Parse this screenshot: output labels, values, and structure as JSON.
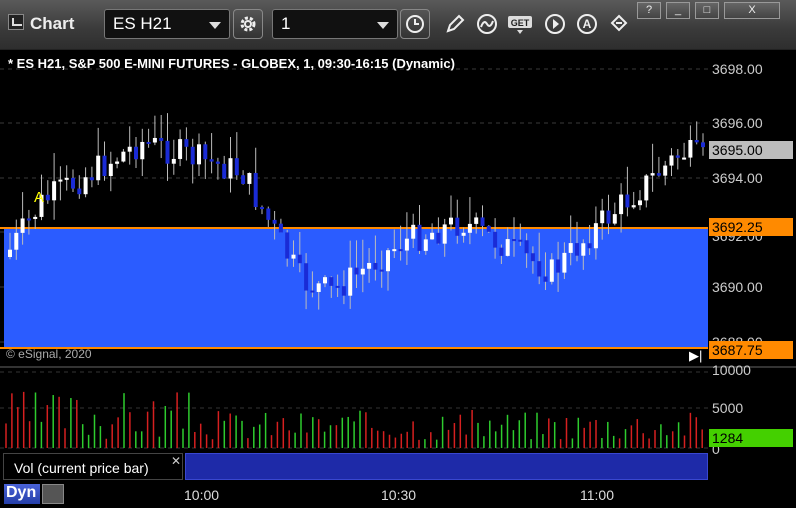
{
  "app": {
    "title": "Chart"
  },
  "toolbar": {
    "symbol": "ES H21",
    "interval": "1",
    "tools": [
      {
        "name": "settings-icon"
      },
      {
        "name": "clock-icon"
      },
      {
        "name": "pencil-icon"
      },
      {
        "name": "curve-icon"
      },
      {
        "name": "get-icon",
        "label": "GET"
      },
      {
        "name": "play-icon"
      },
      {
        "name": "alert-icon",
        "label": "A"
      },
      {
        "name": "link-icon"
      }
    ],
    "window_buttons": [
      "?",
      "_",
      "□",
      "X"
    ]
  },
  "chart": {
    "title": "* ES H21, S&P 500 E-MINI FUTURES - GLOBEX, 1, 09:30-16:15 (Dynamic)",
    "copyright": "© eSignal, 2020",
    "price_labels": [
      "3698.00",
      "3696.00",
      "3694.00",
      "3692.00",
      "3690.00",
      "3688.00"
    ],
    "current_price": "3695.00",
    "upper_level": "3692.25",
    "lower_level": "3687.75",
    "marker": "A",
    "colors": {
      "band": "#2b5cff",
      "level": "#ff8a00",
      "up": "#ffffff",
      "down": "#1a2bd6",
      "background": "#000000"
    }
  },
  "volume": {
    "labels": [
      "10000",
      "5000",
      "0"
    ],
    "current": "1284",
    "study_label": "Vol (current price bar)",
    "colors": {
      "up": "#2ecc2e",
      "down": "#d62020",
      "current": "#44d000"
    }
  },
  "timeaxis": {
    "mode": "Dyn",
    "labels": [
      "10:00",
      "10:30",
      "11:00"
    ]
  }
}
